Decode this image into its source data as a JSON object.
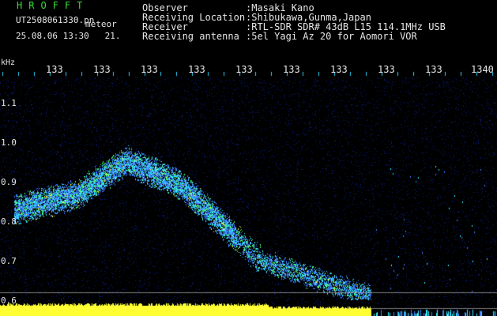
{
  "header": {
    "logo": "HROFFT",
    "file_name": "UT2508061330.pn",
    "file_kind": "meteor",
    "date_time": "25.08.06 13:30",
    "value": "21."
  },
  "info": [
    {
      "label": "Observer",
      "value": ":Masaki Kano"
    },
    {
      "label": "Receiving Location",
      "value": ":Shibukawa,Gunma,Japan"
    },
    {
      "label": "Receiver",
      "value": ":RTL-SDR SDR# 43dB L15 114.1MHz USB"
    },
    {
      "label": "Receiving antenna",
      "value": ":5el Yagi Az 20 for Aomori VOR"
    }
  ],
  "axis": {
    "unit": "kHz",
    "y_ticks": [
      "1.1",
      "1.0",
      "0.9",
      "0.8",
      "0.7",
      "0.6"
    ],
    "x_ticks": [
      "133",
      "133",
      "133",
      "133",
      "133",
      "133",
      "133",
      "133",
      "133",
      "1340"
    ]
  },
  "colors": {
    "background": "#000000",
    "noise_dark": "#0a1a66",
    "signal_blue": "#3f7fff",
    "signal_cyan": "#2ff0ff",
    "signal_green": "#4dff66",
    "signal_yellow": "#ffff33",
    "minute_tick": "#2fd2ff",
    "reference_line": "#cfcfcf"
  }
}
